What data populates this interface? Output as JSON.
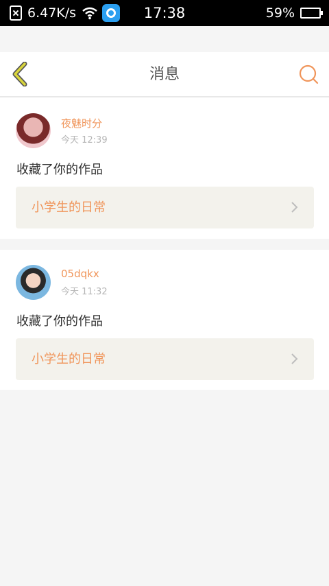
{
  "status_bar": {
    "network_speed": "6.47K/s",
    "time": "17:38",
    "battery_percent": "59%",
    "battery_level": 0.59
  },
  "header": {
    "title": "消息"
  },
  "messages": [
    {
      "username": "夜魅时分",
      "timestamp": "今天 12:39",
      "text": "收藏了你的作品",
      "work_title": "小学生的日常"
    },
    {
      "username": "05dqkx",
      "timestamp": "今天 11:32",
      "text": "收藏了你的作品",
      "work_title": "小学生的日常"
    }
  ],
  "colors": {
    "accent": "#f0955a",
    "back_arrow": "#d9d53c",
    "background": "#f5f5f5"
  }
}
